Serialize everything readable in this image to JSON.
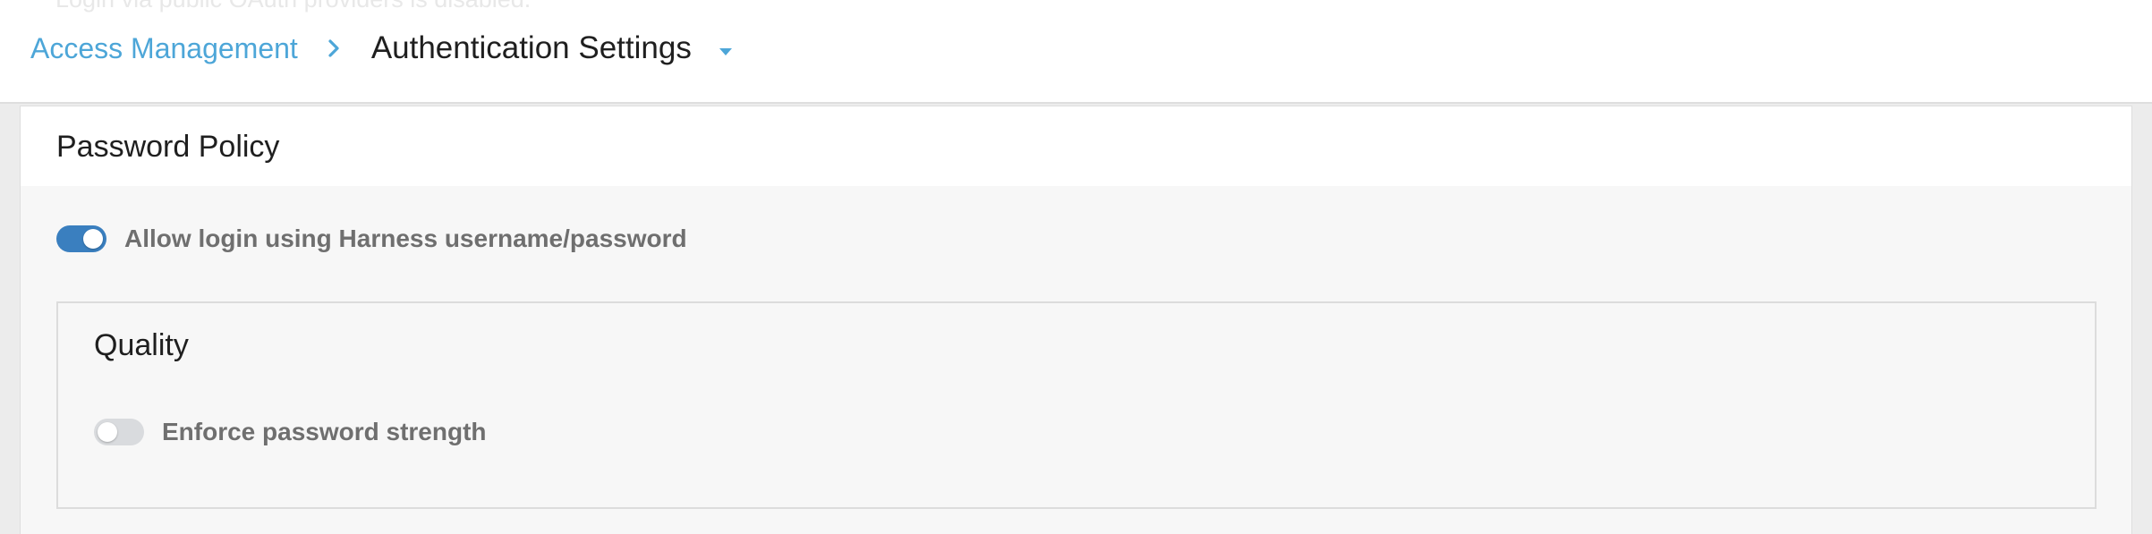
{
  "header": {
    "faded_notice": "Login via public OAuth providers is disabled.",
    "breadcrumb": {
      "parent_label": "Access Management",
      "current_label": "Authentication Settings",
      "separator_icon": "chevron-right-icon",
      "dropdown_icon": "caret-down-icon"
    }
  },
  "password_policy": {
    "title": "Password Policy",
    "allow_login": {
      "label": "Allow login using Harness username/password",
      "enabled": true
    },
    "quality": {
      "title": "Quality",
      "enforce_strength": {
        "label": "Enforce password strength",
        "enabled": false
      }
    }
  },
  "colors": {
    "accent_link": "#4da6d8",
    "toggle_on": "#3a7fbf",
    "toggle_off": "#d9dbde"
  }
}
